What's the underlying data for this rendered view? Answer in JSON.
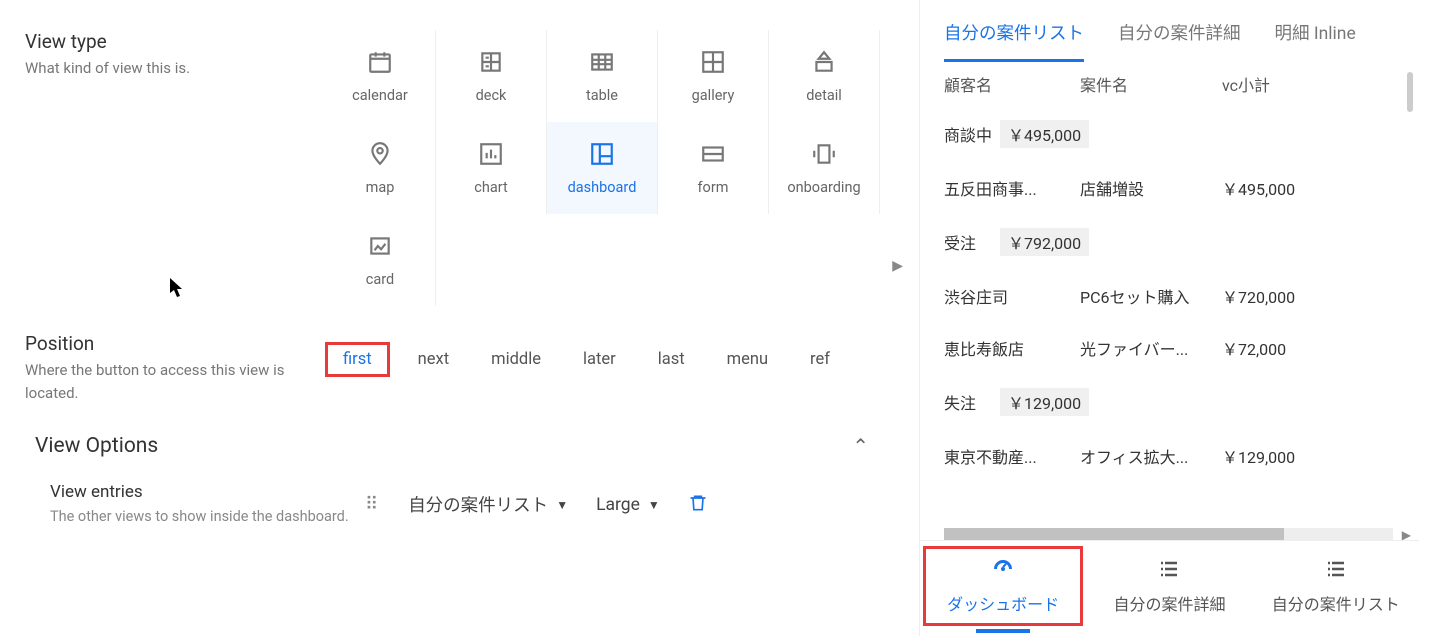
{
  "view_type": {
    "title": "View type",
    "desc": "What kind of view this is.",
    "options": [
      {
        "id": "calendar",
        "label": "calendar"
      },
      {
        "id": "deck",
        "label": "deck"
      },
      {
        "id": "table",
        "label": "table"
      },
      {
        "id": "gallery",
        "label": "gallery"
      },
      {
        "id": "detail",
        "label": "detail"
      },
      {
        "id": "map",
        "label": "map"
      },
      {
        "id": "chart",
        "label": "chart"
      },
      {
        "id": "dashboard",
        "label": "dashboard"
      },
      {
        "id": "form",
        "label": "form"
      },
      {
        "id": "onboarding",
        "label": "onboarding"
      },
      {
        "id": "card",
        "label": "card"
      }
    ],
    "selected": "dashboard"
  },
  "position": {
    "title": "Position",
    "desc": "Where the button to access this view is located.",
    "options": [
      "first",
      "next",
      "middle",
      "later",
      "last",
      "menu",
      "ref"
    ],
    "selected": "first"
  },
  "view_options": {
    "title": "View Options"
  },
  "view_entries": {
    "title": "View entries",
    "desc": "The other views to show inside the dashboard.",
    "entry_view": "自分の案件リスト",
    "entry_size": "Large"
  },
  "preview": {
    "tabs": [
      {
        "label": "自分の案件リスト",
        "active": true
      },
      {
        "label": "自分の案件詳細",
        "active": false
      },
      {
        "label": "明細 Inline",
        "active": false
      }
    ],
    "columns": [
      "顧客名",
      "案件名",
      "vc小計"
    ],
    "groups": [
      {
        "label": "商談中",
        "sum": "￥495,000",
        "rows": [
          {
            "c1": "五反田商事...",
            "c2": "店舗増設",
            "c3": "￥495,000"
          }
        ]
      },
      {
        "label": "受注",
        "sum": "￥792,000",
        "rows": [
          {
            "c1": "渋谷庄司",
            "c2": "PC6セット購入",
            "c3": "￥720,000"
          },
          {
            "c1": "恵比寿飯店",
            "c2": "光ファイバー...",
            "c3": "￥72,000"
          }
        ]
      },
      {
        "label": "失注",
        "sum": "￥129,000",
        "rows": [
          {
            "c1": "東京不動産...",
            "c2": "オフィス拡大...",
            "c3": "￥129,000"
          }
        ]
      }
    ],
    "bottom_nav": [
      {
        "id": "dashboard",
        "label": "ダッシュボード",
        "active": true
      },
      {
        "id": "detail",
        "label": "自分の案件詳細",
        "active": false
      },
      {
        "id": "list",
        "label": "自分の案件リスト",
        "active": false
      }
    ]
  }
}
